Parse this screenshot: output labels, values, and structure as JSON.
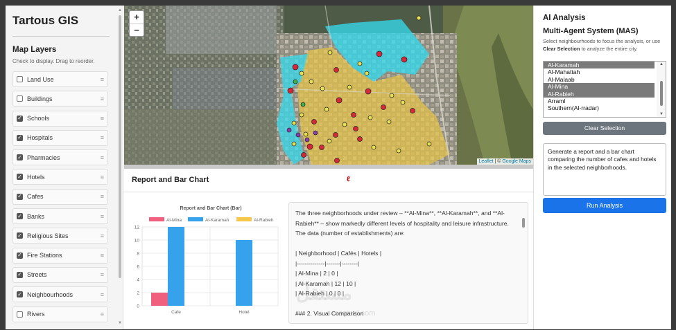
{
  "app": {
    "title": "Tartous GIS"
  },
  "sidebar": {
    "heading": "Map Layers",
    "hint": "Check to display. Drag to reorder.",
    "drag_glyph": "≡",
    "layers": [
      {
        "label": "Land Use",
        "checked": false
      },
      {
        "label": "Buildings",
        "checked": false
      },
      {
        "label": "Schools",
        "checked": true
      },
      {
        "label": "Hospitals",
        "checked": true
      },
      {
        "label": "Pharmacies",
        "checked": true
      },
      {
        "label": "Hotels",
        "checked": true
      },
      {
        "label": "Cafes",
        "checked": true
      },
      {
        "label": "Banks",
        "checked": true
      },
      {
        "label": "Religious Sites",
        "checked": true
      },
      {
        "label": "Fire Stations",
        "checked": true
      },
      {
        "label": "Streets",
        "checked": true
      },
      {
        "label": "Neighbourhoods",
        "checked": true
      },
      {
        "label": "Rivers",
        "checked": false
      }
    ]
  },
  "map": {
    "zoom_in": "+",
    "zoom_out": "−",
    "attribution_leaflet": "Leaflet",
    "attribution_sep": " | © ",
    "attribution_google": "Google Maps",
    "colors": {
      "cyan": "#33d6e8",
      "yellow": "#e8c84a",
      "marker_red": "#d62839",
      "marker_yellow": "#e8e050",
      "marker_purple": "#8a3fb0"
    }
  },
  "report": {
    "title": "Report and Bar Chart",
    "red_mark": "ℓ",
    "text_lines": [
      "The three neighborhoods under review – **Al-Mina**, **Al-Karamah**, and **Al-Rabieh** – show markedly different levels of hospitality and leisure infrastructure. The data (number of establishments) are:",
      "",
      "| Neighborhood | Cafés | Hotels |",
      "|--------------|-------|--------|",
      "| Al-Mina | 2 | 0 |",
      "| Al-Karamah | 12 | 10 |",
      "| Al-Rabieh | 0 | 0 |",
      "",
      "### 2. Visual Comparison"
    ],
    "watermark": "مستقل",
    "watermark_sub": "mostaql.com"
  },
  "chart_data": {
    "type": "bar",
    "title": "Report and Bar Chart (Bar)",
    "categories": [
      "Cafe",
      "Hotel"
    ],
    "series": [
      {
        "name": "Al-Mina",
        "values": [
          2,
          0
        ],
        "color": "#f0607e"
      },
      {
        "name": "Al-Karamah",
        "values": [
          12,
          10
        ],
        "color": "#36a2eb"
      },
      {
        "name": "Al-Rabieh",
        "values": [
          0,
          0
        ],
        "color": "#f5c84c"
      }
    ],
    "ylim": [
      0,
      12
    ],
    "yticks": [
      0,
      2,
      4,
      6,
      8,
      10,
      12
    ],
    "grid": true,
    "legend": "top"
  },
  "ai": {
    "title": "AI Analysis",
    "subtitle": "Multi-Agent System (MAS)",
    "desc_before": "Select neighbourhoods to focus the analysis, or use ",
    "desc_bold": "Clear Selection",
    "desc_after": " to analyze the entire city.",
    "options": [
      {
        "label": "Al-Karamah",
        "selected": true
      },
      {
        "label": "Al-Mahattah",
        "selected": false
      },
      {
        "label": "Al-Malaab",
        "selected": false
      },
      {
        "label": "Al-Mina",
        "selected": true
      },
      {
        "label": "Al-Rabieh",
        "selected": true
      },
      {
        "label": "Arraml",
        "selected": false
      },
      {
        "label": "Southern(Al-rradar)",
        "selected": false
      }
    ],
    "clear_label": "Clear Selection",
    "prompt": "Generate a report and a bar chart comparing the number of cafes and hotels in the selected neighborhoods.",
    "run_label": "Run Analysis"
  }
}
